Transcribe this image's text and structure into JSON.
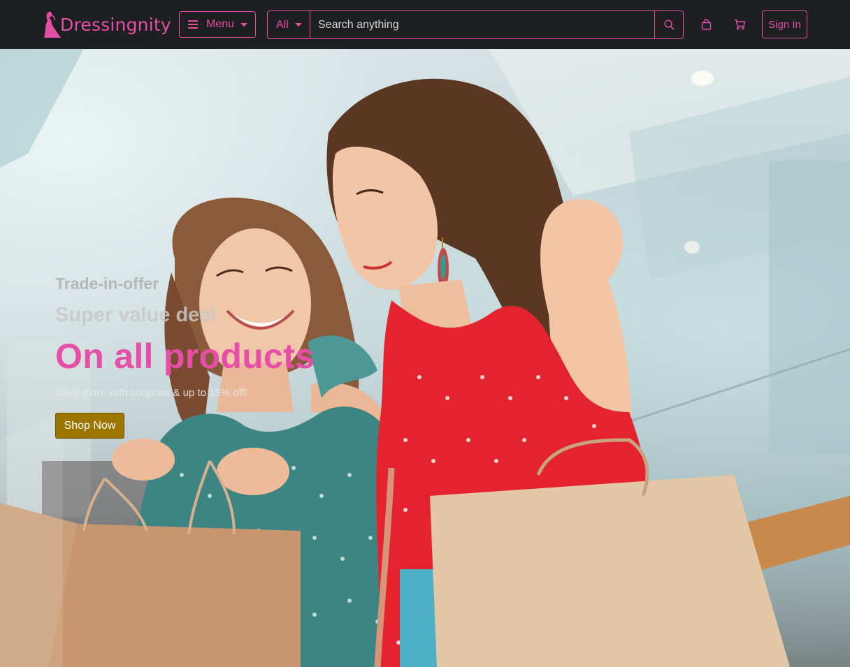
{
  "brand": {
    "name": "Dressingnity",
    "logo_icon": "woman-silhouette-icon",
    "color": "#e64ea8"
  },
  "nav": {
    "menu_label": "Menu",
    "category_selected": "All",
    "search_placeholder": "Search anything",
    "signin_label": "Sign In",
    "icons": [
      "search-icon",
      "bag-icon",
      "cart-icon"
    ]
  },
  "hero": {
    "kicker": "Trade-in-offer",
    "headline": "Super value deal",
    "title": "On all products",
    "subtext": "Save more with coupons & up to 15% off!",
    "cta_label": "Shop Now",
    "cta_color": "#9b7500"
  },
  "theme": {
    "nav_bg": "#1d1f21",
    "accent": "#e64ea8"
  }
}
